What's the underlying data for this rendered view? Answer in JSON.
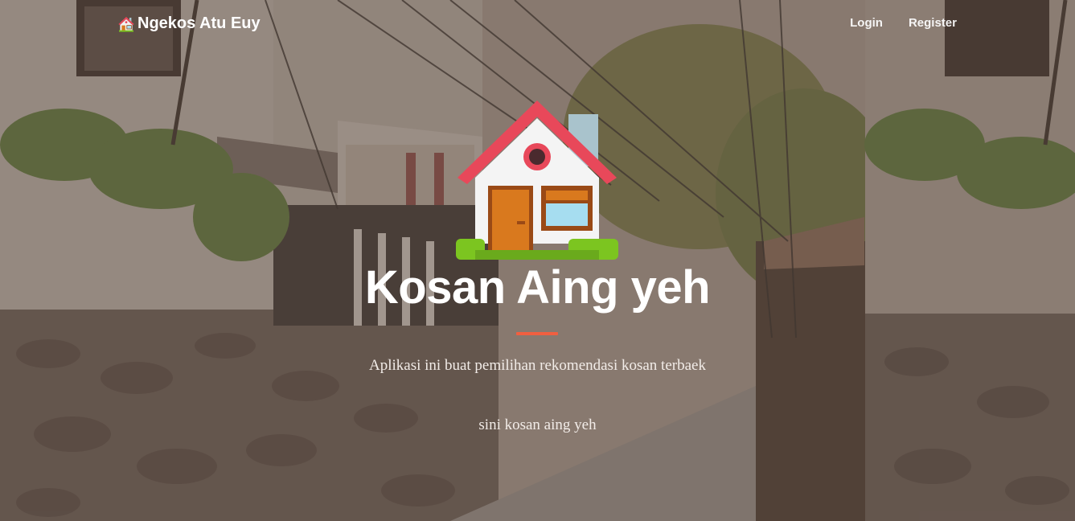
{
  "navbar": {
    "brand_icon": "house-icon",
    "brand_label": "Ngekos Atu Euy",
    "links": [
      {
        "label": "Login"
      },
      {
        "label": "Register"
      }
    ]
  },
  "hero": {
    "icon": "house-icon",
    "title": "Kosan Aing yeh",
    "subtitle": "Aplikasi ini buat pemilihan rekomendasi kosan terbaek",
    "tagline": "sini kosan aing yeh"
  },
  "colors": {
    "accent": "#f05f40",
    "roof": "#e8485a",
    "door": "#d9791e",
    "grass": "#7cc520",
    "overlay": "#46342c"
  }
}
